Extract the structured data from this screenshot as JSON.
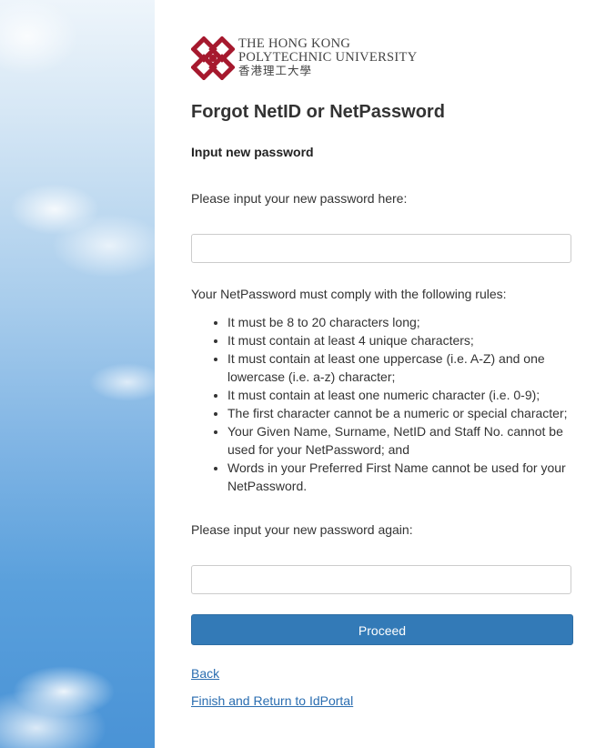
{
  "logo": {
    "line1": "THE HONG KONG",
    "line2": "POLYTECHNIC UNIVERSITY",
    "line3": "香港理工大學",
    "color": "#a6192e"
  },
  "page": {
    "title": "Forgot NetID or NetPassword",
    "section_title": "Input new password",
    "prompt_new": "Please input your new password here:",
    "rules_intro": "Your NetPassword must comply with the following rules:",
    "rules": [
      "It must be 8 to 20 characters long;",
      "It must contain at least 4 unique characters;",
      "It must contain at least one uppercase (i.e. A-Z) and one lowercase (i.e. a-z) character;",
      "It must contain at least one numeric character (i.e. 0-9);",
      "The first character cannot be a numeric or special character;",
      "Your Given Name, Surname, NetID and Staff No. cannot be used for your NetPassword; and",
      "Words in your Preferred First Name cannot be used for your NetPassword."
    ],
    "prompt_again": "Please input your new password again:",
    "new_password_value": "",
    "confirm_password_value": "",
    "proceed_label": "Proceed",
    "back_label": "Back",
    "finish_label": "Finish and Return to IdPortal"
  },
  "colors": {
    "button": "#337ab7",
    "link": "#2a6db0"
  }
}
